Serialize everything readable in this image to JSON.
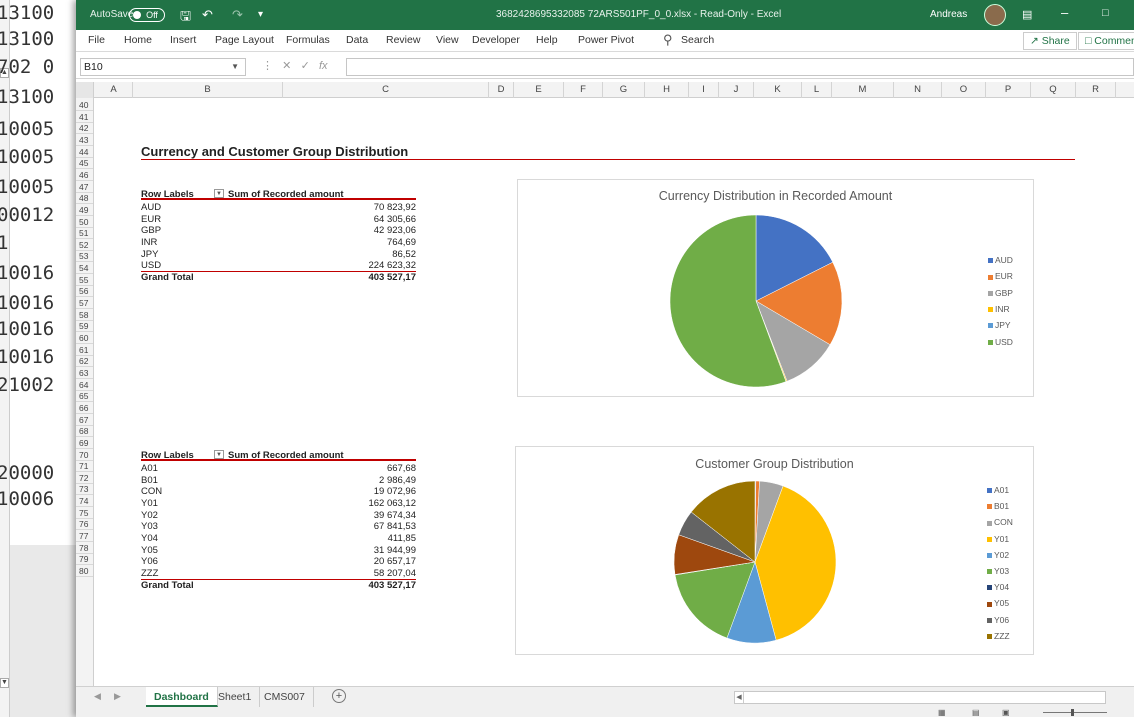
{
  "background_window": {
    "lines": [
      "13100",
      "13100",
      "702 0",
      "13100",
      "10005",
      "10005",
      "10005",
      "00012",
      "1",
      "10016",
      "10016",
      "10016",
      "10016",
      "21002",
      "20000",
      "10006"
    ]
  },
  "titlebar": {
    "autosave_label": "AutoSave",
    "autosave_state": "Off",
    "file_title": "3682428695332085 72ARS501PF_0_0.xlsx - Read-Only - Excel",
    "user_name": "Andreas",
    "colors": {
      "excel_green": "#217346"
    }
  },
  "ribbon": {
    "tabs": [
      "File",
      "Home",
      "Insert",
      "Page Layout",
      "Formulas",
      "Data",
      "Review",
      "View",
      "Developer",
      "Help",
      "Power Pivot"
    ],
    "search_label": "Search",
    "share_label": "Share",
    "comments_label": "Comments"
  },
  "formula_bar": {
    "name_box": "B10",
    "fx_label": "fx",
    "content": ""
  },
  "columns": [
    "A",
    "B",
    "C",
    "D",
    "E",
    "F",
    "G",
    "H",
    "I",
    "J",
    "K",
    "L",
    "M",
    "N",
    "O",
    "P",
    "Q",
    "R"
  ],
  "rows": [
    "40",
    "41",
    "42",
    "43",
    "44",
    "45",
    "46",
    "47",
    "48",
    "49",
    "50",
    "51",
    "52",
    "53",
    "54",
    "55",
    "56",
    "57",
    "58",
    "59",
    "60",
    "61",
    "62",
    "63",
    "64",
    "65",
    "66",
    "67",
    "68",
    "69",
    "70",
    "71",
    "72",
    "73",
    "74",
    "75",
    "76",
    "77",
    "78",
    "79",
    "80"
  ],
  "dashboard": {
    "section_title": "Currency and Customer Group Distribution",
    "pivot1": {
      "header_label": "Row Labels",
      "header_value": "Sum of Recorded amount",
      "rows": [
        {
          "label": "AUD",
          "value": "70 823,92"
        },
        {
          "label": "EUR",
          "value": "64 305,66"
        },
        {
          "label": "GBP",
          "value": "42 923,06"
        },
        {
          "label": "INR",
          "value": "764,69"
        },
        {
          "label": "JPY",
          "value": "86,52"
        },
        {
          "label": "USD",
          "value": "224 623,32"
        }
      ],
      "total_label": "Grand Total",
      "total_value": "403 527,17"
    },
    "pivot2": {
      "header_label": "Row Labels",
      "header_value": "Sum of Recorded amount",
      "rows": [
        {
          "label": "A01",
          "value": "667,68"
        },
        {
          "label": "B01",
          "value": "2 986,49"
        },
        {
          "label": "CON",
          "value": "19 072,96"
        },
        {
          "label": "Y01",
          "value": "162 063,12"
        },
        {
          "label": "Y02",
          "value": "39 674,34"
        },
        {
          "label": "Y03",
          "value": "67 841,53"
        },
        {
          "label": "Y04",
          "value": "411,85"
        },
        {
          "label": "Y05",
          "value": "31 944,99"
        },
        {
          "label": "Y06",
          "value": "20 657,17"
        },
        {
          "label": "ZZZ",
          "value": "58 207,04"
        }
      ],
      "total_label": "Grand Total",
      "total_value": "403 527,17"
    }
  },
  "chart_data": [
    {
      "type": "pie",
      "title": "Currency Distribution in Recorded Amount",
      "categories": [
        "AUD",
        "EUR",
        "GBP",
        "INR",
        "JPY",
        "USD"
      ],
      "values": [
        70823.92,
        64305.66,
        42923.06,
        764.69,
        86.52,
        224623.32
      ],
      "colors": [
        "#4472c4",
        "#ed7d31",
        "#a5a5a5",
        "#ffc000",
        "#5b9bd5",
        "#70ad47"
      ],
      "legend_position": "right"
    },
    {
      "type": "pie",
      "title": "Customer Group Distribution",
      "categories": [
        "A01",
        "B01",
        "CON",
        "Y01",
        "Y02",
        "Y03",
        "Y04",
        "Y05",
        "Y06",
        "ZZZ"
      ],
      "values": [
        667.68,
        2986.49,
        19072.96,
        162063.12,
        39674.34,
        67841.53,
        411.85,
        31944.99,
        20657.17,
        58207.04
      ],
      "colors": [
        "#4472c4",
        "#ed7d31",
        "#a5a5a5",
        "#ffc000",
        "#5b9bd5",
        "#70ad47",
        "#264478",
        "#9e480e",
        "#636363",
        "#997300"
      ],
      "legend_position": "right"
    }
  ],
  "sheet_tabs": [
    "Dashboard",
    "Sheet1",
    "CMS007"
  ],
  "active_sheet": "Dashboard",
  "icons": {
    "add_sheet": "plus-circle-icon",
    "search": "search-icon",
    "save": "save-icon",
    "undo": "undo-icon",
    "redo": "redo-icon"
  }
}
